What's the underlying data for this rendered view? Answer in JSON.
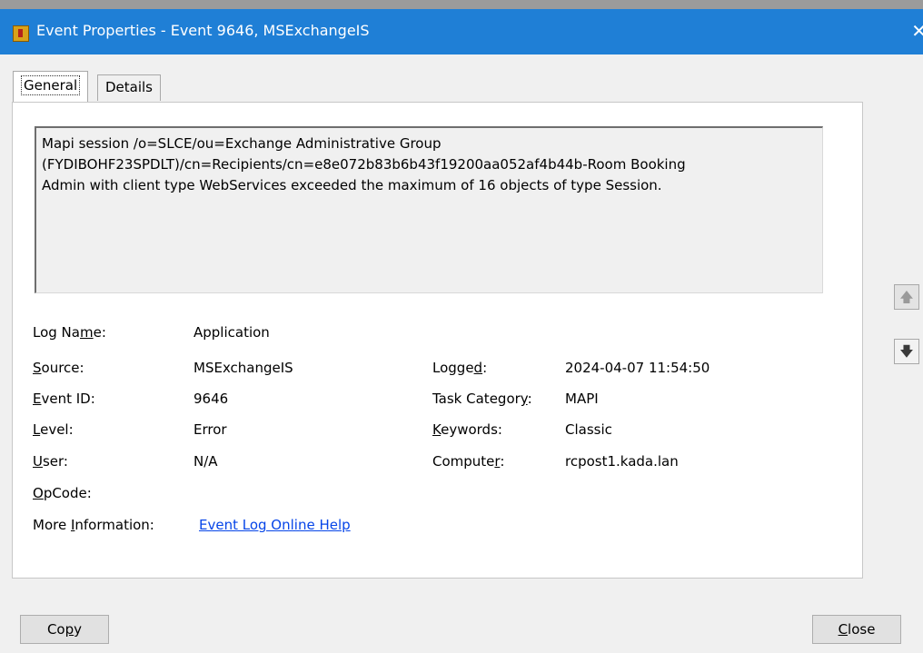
{
  "window": {
    "title": "Event Properties - Event 9646, MSExchangeIS",
    "close_glyph": "✕",
    "icon": "event-viewer-icon"
  },
  "tabs": [
    {
      "label": "General",
      "active": true
    },
    {
      "label": "Details",
      "active": false
    }
  ],
  "description": "Mapi session /o=SLCE/ou=Exchange Administrative Group\n(FYDIBOHF23SPDLT)/cn=Recipients/cn=e8e072b83b6b43f19200aa052af4b44b-Room Booking\nAdmin with client type WebServices exceeded the maximum of 16 objects of type Session.",
  "fields": {
    "log_name": {
      "pre": "Log Na",
      "ul": "m",
      "post": "e:",
      "value": "Application"
    },
    "source": {
      "pre": "",
      "ul": "S",
      "post": "ource:",
      "value": "MSExchangeIS"
    },
    "event_id": {
      "pre": "",
      "ul": "E",
      "post": "vent ID:",
      "value": "9646"
    },
    "level": {
      "pre": "",
      "ul": "L",
      "post": "evel:",
      "value": "Error"
    },
    "user": {
      "pre": "",
      "ul": "U",
      "post": "ser:",
      "value": "N/A"
    },
    "opcode": {
      "pre": "",
      "ul": "O",
      "post": "pCode:",
      "value": ""
    },
    "more_info": {
      "pre": "More ",
      "ul": "I",
      "post": "nformation:",
      "link": "Event Log Online Help"
    },
    "logged": {
      "pre": "Logge",
      "ul": "d",
      "post": ":",
      "value": "2024-04-07 11:54:50"
    },
    "task_category": {
      "pre": "Task Categor",
      "ul": "y",
      "post": ":",
      "value": "MAPI"
    },
    "keywords": {
      "pre": "",
      "ul": "K",
      "post": "eywords:",
      "value": "Classic"
    },
    "computer": {
      "pre": "Compute",
      "ul": "r",
      "post": ":",
      "value": "rcpost1.kada.lan"
    }
  },
  "nav": {
    "up_glyph": "🡅",
    "down_glyph": "🡇",
    "up_icon": "arrow-up-icon",
    "down_icon": "arrow-down-icon"
  },
  "buttons": {
    "copy": {
      "pre": "Co",
      "ul": "p",
      "post": "y"
    },
    "close": {
      "pre": "",
      "ul": "C",
      "post": "lose"
    }
  }
}
